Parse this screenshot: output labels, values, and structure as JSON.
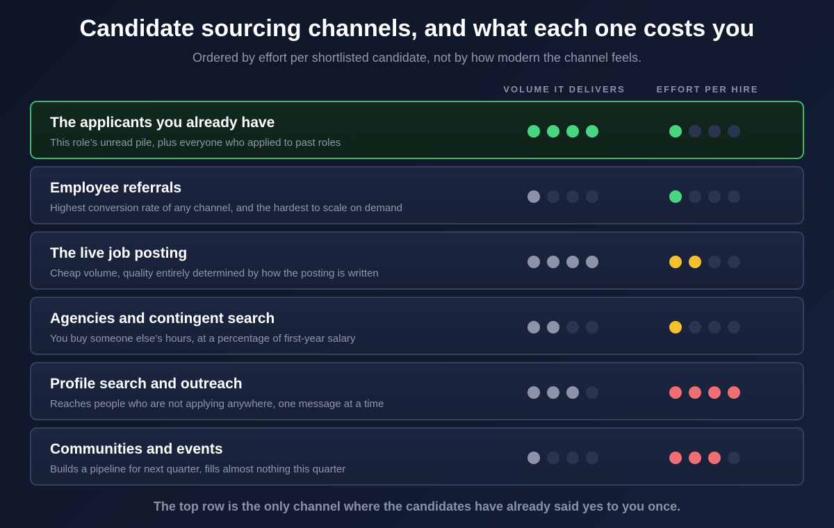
{
  "header": {
    "title": "Candidate sourcing channels, and what each one costs you",
    "subtitle": "Ordered by effort per shortlisted candidate, not by how modern the channel feels."
  },
  "columns": {
    "volume": "VOLUME IT DELIVERS",
    "effort": "EFFORT PER HIRE"
  },
  "scale_max": 4,
  "colors": {
    "highlight_border": "#3fba6c",
    "dot_empty": "#2c3550",
    "dot_volume": "#8d93a8",
    "dot_green": "#4ad681",
    "dot_yellow": "#f5c12e",
    "dot_red": "#ef6f74"
  },
  "rows": [
    {
      "title": "The applicants you already have",
      "description": "This role’s unread pile, plus everyone who applied to past roles",
      "highlighted": true,
      "volume": 4,
      "volume_color": "green",
      "effort": 1,
      "effort_color": "green"
    },
    {
      "title": "Employee referrals",
      "description": "Highest conversion rate of any channel, and the hardest to scale on demand",
      "highlighted": false,
      "volume": 1,
      "volume_color": "gray",
      "effort": 1,
      "effort_color": "green"
    },
    {
      "title": "The live job posting",
      "description": "Cheap volume, quality entirely determined by how the posting is written",
      "highlighted": false,
      "volume": 4,
      "volume_color": "gray",
      "effort": 2,
      "effort_color": "yellow"
    },
    {
      "title": "Agencies and contingent search",
      "description": "You buy someone else’s hours, at a percentage of first-year salary",
      "highlighted": false,
      "volume": 2,
      "volume_color": "gray",
      "effort": 1,
      "effort_color": "yellow"
    },
    {
      "title": "Profile search and outreach",
      "description": "Reaches people who are not applying anywhere, one message at a time",
      "highlighted": false,
      "volume": 3,
      "volume_color": "gray",
      "effort": 4,
      "effort_color": "red"
    },
    {
      "title": "Communities and events",
      "description": "Builds a pipeline for next quarter, fills almost nothing this quarter",
      "highlighted": false,
      "volume": 1,
      "volume_color": "gray",
      "effort": 3,
      "effort_color": "red"
    }
  ],
  "footer": "The top row is the only channel where the candidates have already said yes to you once."
}
